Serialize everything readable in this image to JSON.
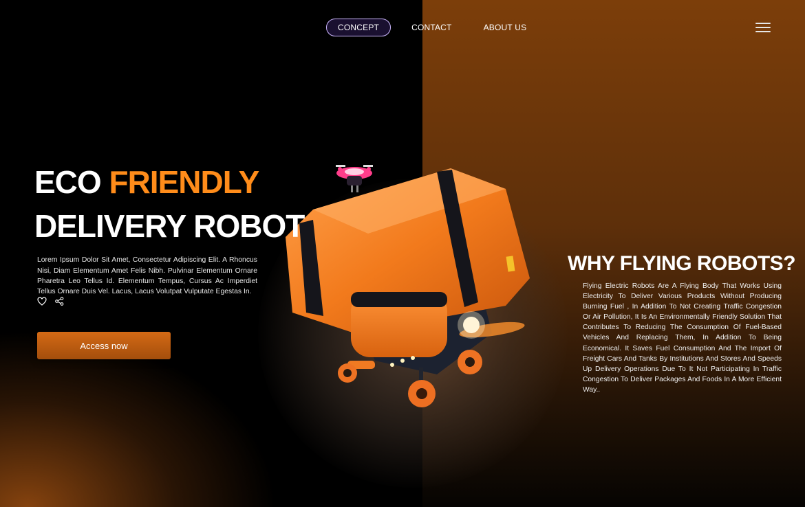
{
  "nav": {
    "items": [
      {
        "label": "CONCEPT",
        "active": true
      },
      {
        "label": "CONTACT",
        "active": false
      },
      {
        "label": "ABOUT US",
        "active": false
      }
    ],
    "menu_icon": "hamburger-menu-icon"
  },
  "hero": {
    "title_word1": "ECO",
    "title_word2": "FRIENDLY",
    "title_line2": "DELIVERY ROBOT",
    "description": "Lorem Ipsum Dolor Sit Amet, Consectetur Adipiscing Elit. A Rhoncus Nisi, Diam Elementum Amet Felis Nibh. Pulvinar Elementum Ornare Pharetra Leo Tellus Id. Elementum Tempus, Cursus Ac Imperdiet Tellus Ornare Duis Vel. Lacus, Lacus Volutpat Vulputate Egestas In.",
    "icons": [
      "heart-icon",
      "share-icon"
    ],
    "cta_label": "Access now"
  },
  "why": {
    "title": "WHY FLYING ROBOTS?",
    "description": "Flying Electric Robots Are A Flying Body That Works Using Electricity To Deliver Various Products Without Producing Burning Fuel , In Addition To Not Creating Traffic Congestion Or Air Pollution, It Is An Environmentally Friendly Solution That Contributes To Reducing The Consumption Of Fuel-Based Vehicles And Replacing Them, In Addition To Being Economical. It Saves Fuel Consumption And The Import Of Freight Cars And Tanks By Institutions And Stores And Speeds Up Delivery Operations Due To It Not Participating In Traffic Congestion To Deliver Packages And Foods In A More Efficient Way.."
  },
  "colors": {
    "accent": "#ff8c1a",
    "cta": "#c2600f",
    "right_panel": "#7c3e0a",
    "nav_active_border": "#cdb8ff"
  }
}
